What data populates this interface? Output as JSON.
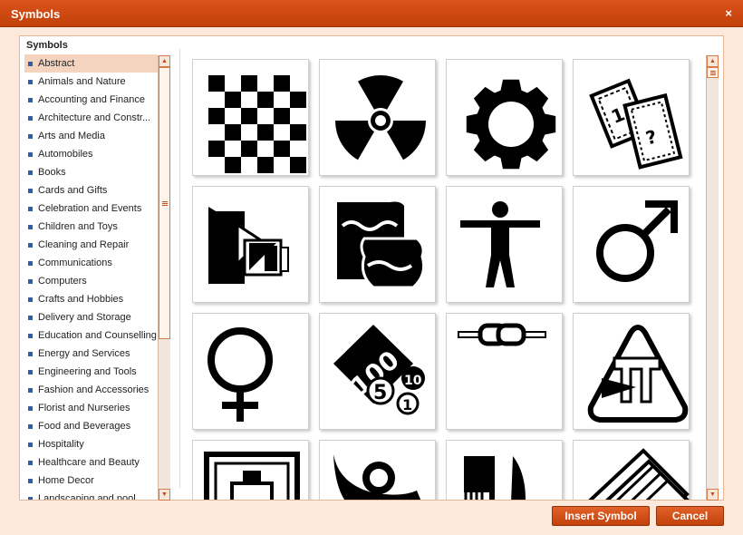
{
  "dialog": {
    "title": "Symbols",
    "close_label": "×"
  },
  "categories": {
    "header": "Symbols",
    "selected_index": 0,
    "items": [
      "Abstract",
      "Animals and Nature",
      "Accounting and Finance",
      "Architecture and Constr...",
      "Arts and Media",
      "Automobiles",
      "Books",
      "Cards and Gifts",
      "Celebration and Events",
      "Children and Toys",
      "Cleaning and Repair",
      "Communications",
      "Computers",
      "Crafts and Hobbies",
      "Delivery and Storage",
      "Education and Counselling",
      "Energy and Services",
      "Engineering and Tools",
      "Fashion and Accessories",
      "Florist and Nurseries",
      "Food and Beverages",
      "Hospitality",
      "Healthcare and Beauty",
      "Home Decor",
      "Landscaping and pool"
    ]
  },
  "symbols": [
    {
      "icon": "checkerboard-icon"
    },
    {
      "icon": "radiation-icon"
    },
    {
      "icon": "gear-icon"
    },
    {
      "icon": "lottery-tickets-icon"
    },
    {
      "icon": "abstract-shapes-icon"
    },
    {
      "icon": "pottery-icon"
    },
    {
      "icon": "human-figure-icon"
    },
    {
      "icon": "male-symbol-icon"
    },
    {
      "icon": "female-symbol-icon"
    },
    {
      "icon": "coins-icon"
    },
    {
      "icon": "chain-icon"
    },
    {
      "icon": "pi-sign-icon"
    },
    {
      "icon": "clipboard-frame-icon"
    },
    {
      "icon": "post-horn-icon"
    },
    {
      "icon": "comb-knife-icon"
    },
    {
      "icon": "stacked-papers-icon"
    }
  ],
  "buttons": {
    "insert": "Insert Symbol",
    "cancel": "Cancel"
  },
  "colors": {
    "accent": "#c2410a",
    "background": "#fde9dc",
    "selection": "#f4d4bf"
  }
}
